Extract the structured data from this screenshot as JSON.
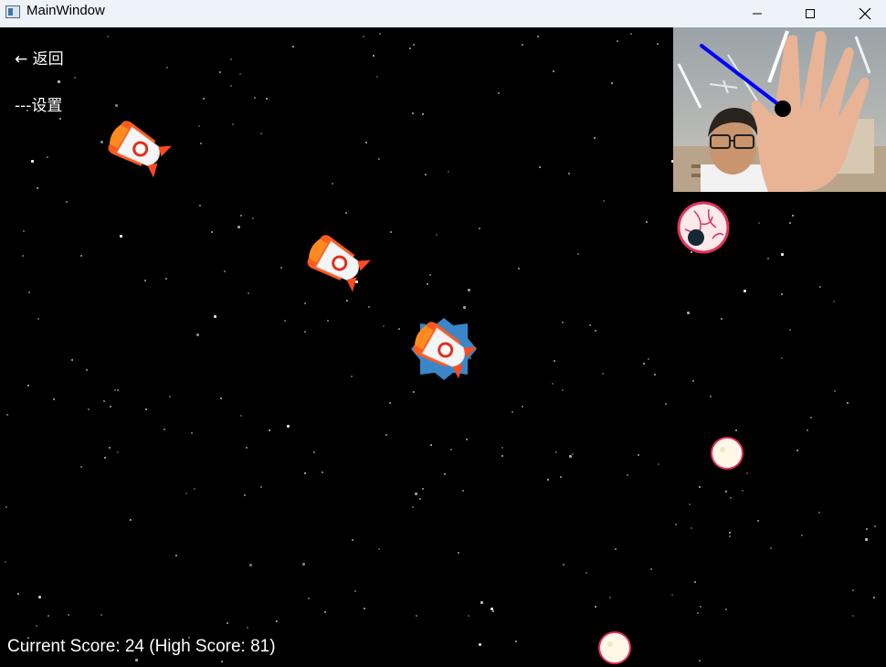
{
  "window": {
    "title": "MainWindow",
    "icon": "app-window-icon",
    "controls": [
      "minimize-icon",
      "maximize-icon",
      "close-icon"
    ]
  },
  "menu": {
    "back_label": "← 返回",
    "settings_label": "---设置"
  },
  "hud": {
    "score_text": "Current Score: 24 (High Score: 81)",
    "current_score": 24,
    "high_score": 81
  },
  "webcam": {
    "description": "hand-tracking-camera-feed",
    "pointer_color": "#0000ff",
    "cursor_color": "#000000"
  },
  "sprites": {
    "rockets": [
      "rocket-enemy",
      "rocket-enemy",
      "rocket-player-shielded"
    ],
    "planets": [
      "eyeball-planet",
      "moon-planet",
      "moon-planet"
    ]
  },
  "colors": {
    "background": "#000000",
    "titlebar": "#eef2f9",
    "rocket_body": "#f5f5f5",
    "rocket_nose": "#ff5a1e",
    "shield": "#3a86c8",
    "planet_rim": "#e0325a",
    "moon_fill": "#fff8e8"
  }
}
